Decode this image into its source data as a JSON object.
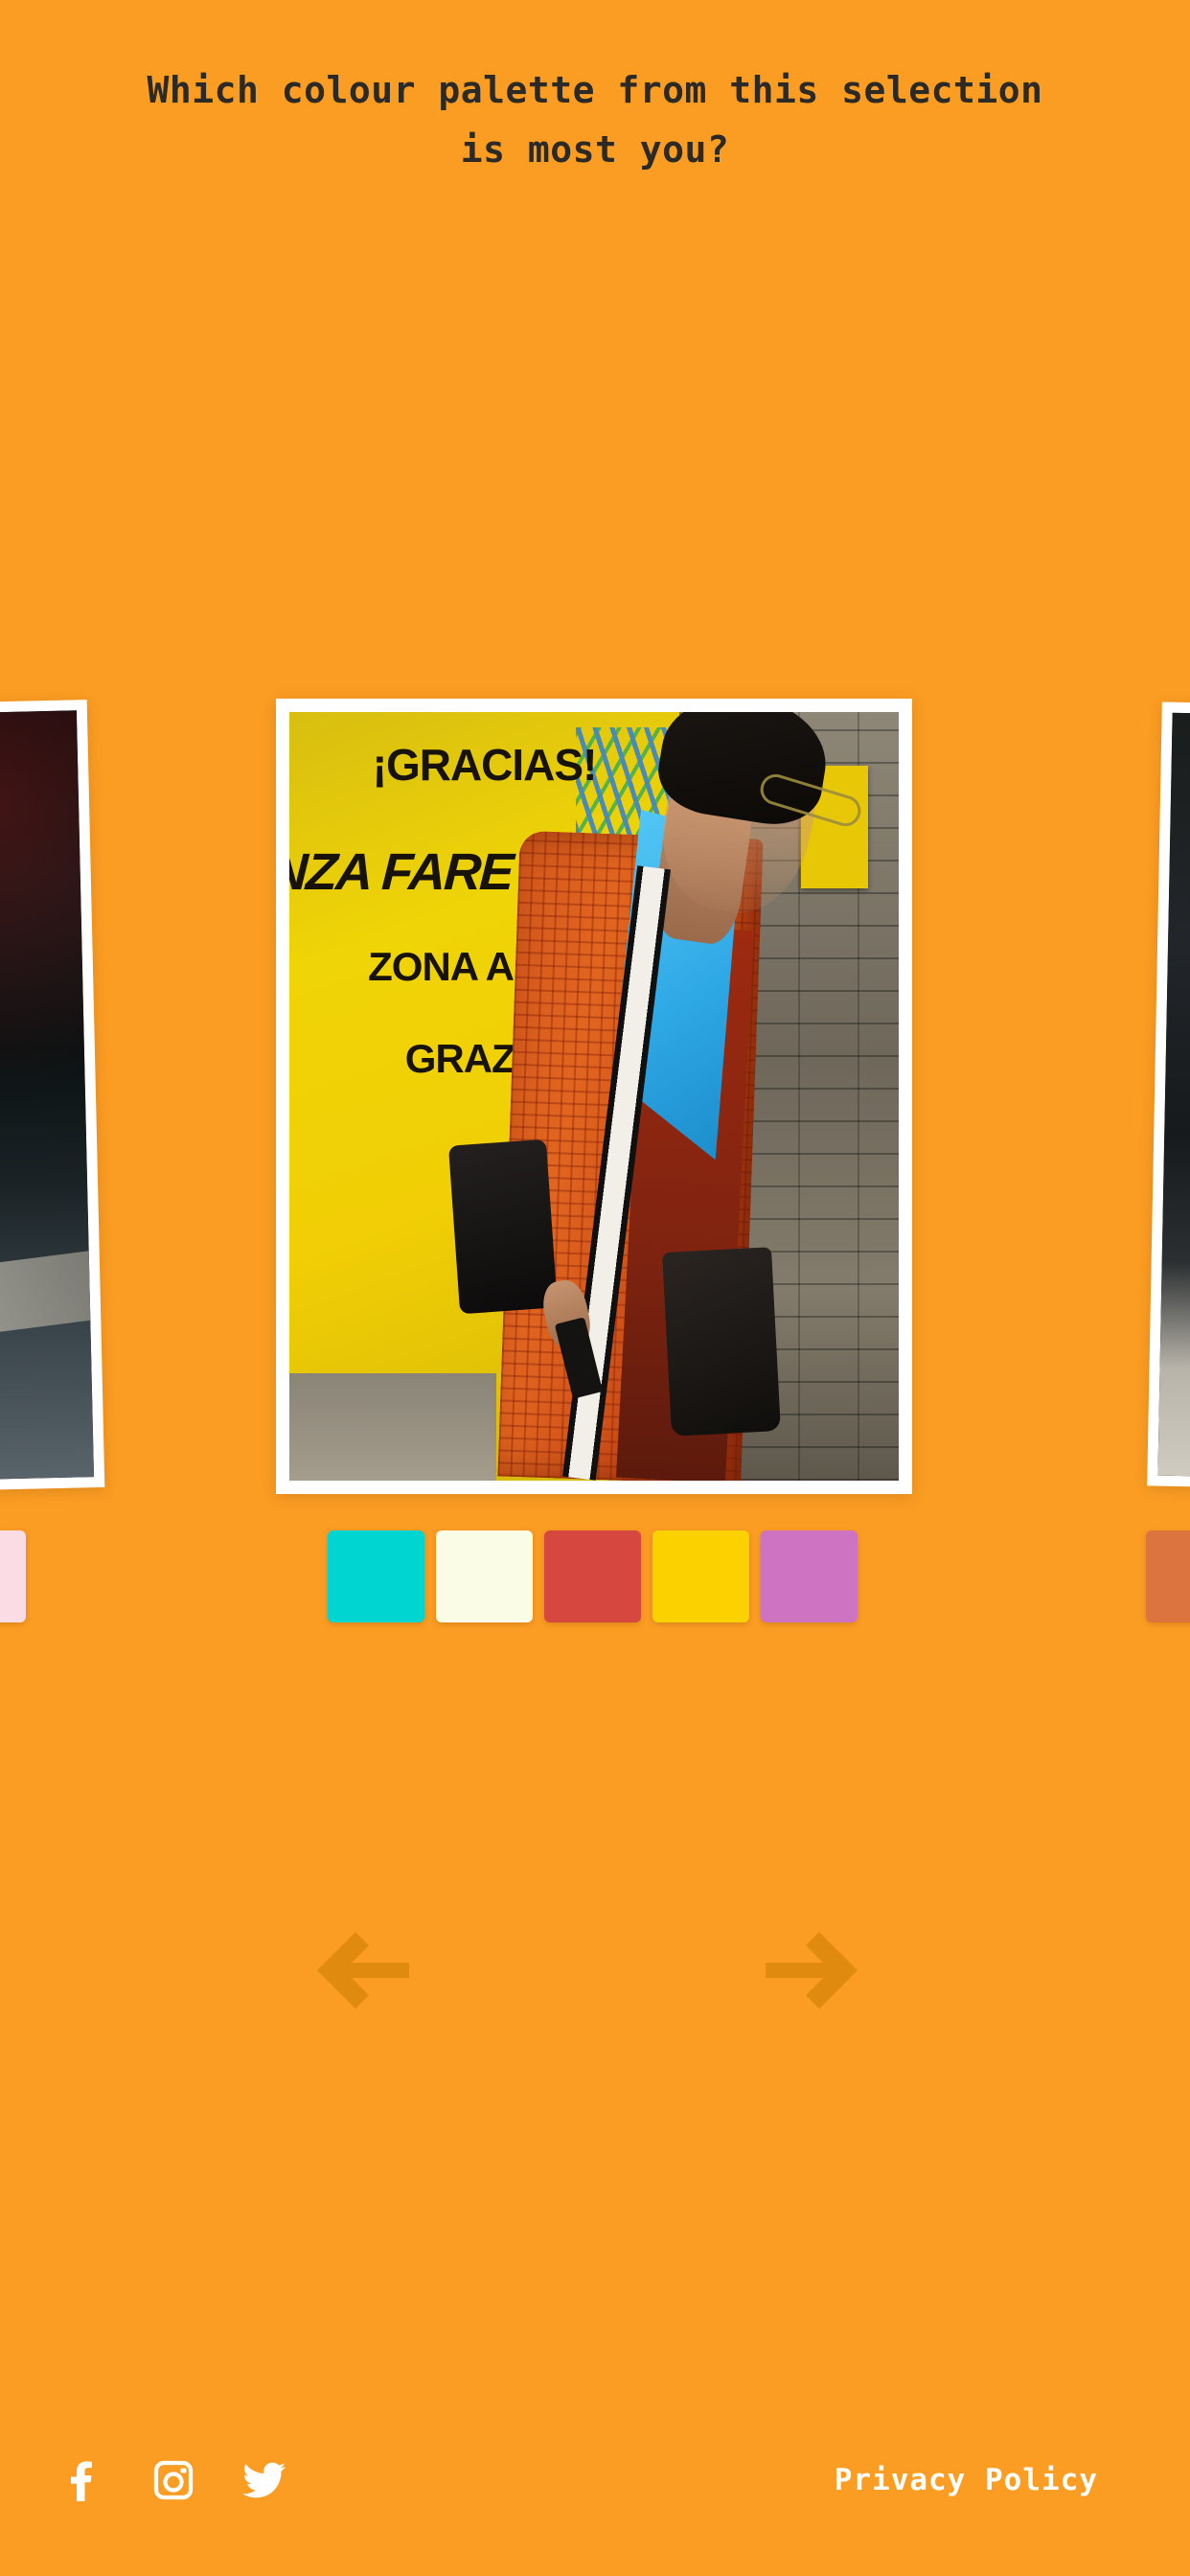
{
  "page": {
    "background_color": "#FB9D23",
    "heading": "Which colour palette from this selection is most you?",
    "heading_color": "#2B2A26"
  },
  "carousel": {
    "active_index": 1,
    "slides": [
      {
        "position": "left-peek",
        "image_alt": "Dark moody street scene",
        "palette": [
          {
            "name": "blush-pink",
            "hex": "#FBDCE4"
          }
        ]
      },
      {
        "position": "center-active",
        "image_alt": "Street style portrait of a person in an orange checked coat in front of a yellow sign",
        "image_text": {
          "line_1": "¡GRACIAS!",
          "line_2": "NZA FARE TROP",
          "line_3": "ZONA ABITA",
          "line_4": "GRAZIE!"
        },
        "palette": [
          {
            "name": "turquoise",
            "hex": "#00D5D2"
          },
          {
            "name": "ivory",
            "hex": "#FBFCE6"
          },
          {
            "name": "brick-red",
            "hex": "#D6473F"
          },
          {
            "name": "gold",
            "hex": "#FBD200"
          },
          {
            "name": "orchid",
            "hex": "#CE72C2"
          }
        ]
      },
      {
        "position": "right-peek",
        "image_alt": "Dark greyscale street photograph",
        "palette": [
          {
            "name": "terracotta",
            "hex": "#DC7440"
          }
        ]
      }
    ],
    "prev_label": "Previous palette",
    "next_label": "Next palette",
    "arrow_color": "#E08A10"
  },
  "footer": {
    "social": [
      {
        "name": "facebook",
        "icon": "facebook-icon",
        "label": "Facebook"
      },
      {
        "name": "instagram",
        "icon": "instagram-icon",
        "label": "Instagram"
      },
      {
        "name": "twitter",
        "icon": "twitter-icon",
        "label": "Twitter"
      }
    ],
    "privacy_label": "Privacy Policy",
    "text_color": "#FFFFFF"
  }
}
